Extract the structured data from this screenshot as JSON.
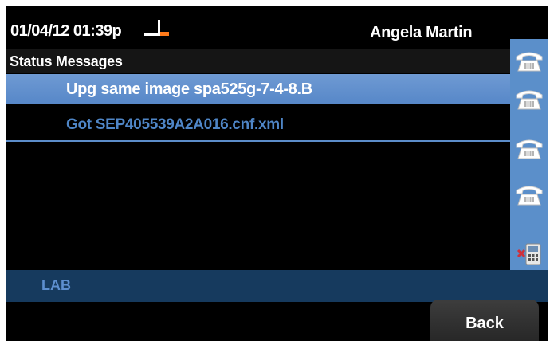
{
  "header": {
    "datetime": "01/04/12 01:39p",
    "user_name": "Angela Martin",
    "phone_icon": "offhook-handset-icon"
  },
  "title": "Status Messages",
  "messages": [
    {
      "text": "Upg same  image spa525g-7-4-8.B",
      "selected": true
    },
    {
      "text": "Got SEP405539A2A016.cnf.xml",
      "selected": false
    }
  ],
  "line_keys": [
    {
      "icon": "phone-line-icon"
    },
    {
      "icon": "phone-line-icon"
    },
    {
      "icon": "phone-line-icon"
    },
    {
      "icon": "phone-line-icon"
    },
    {
      "icon": "no-speed-dial-icon"
    }
  ],
  "label_bar": "LAB",
  "softkeys": {
    "back": "Back"
  },
  "colors": {
    "selected_row": "#5f8ecc",
    "line_strip": "#5b8fca",
    "label_bar": "#163a5e",
    "message_text": "#4f86c7"
  }
}
